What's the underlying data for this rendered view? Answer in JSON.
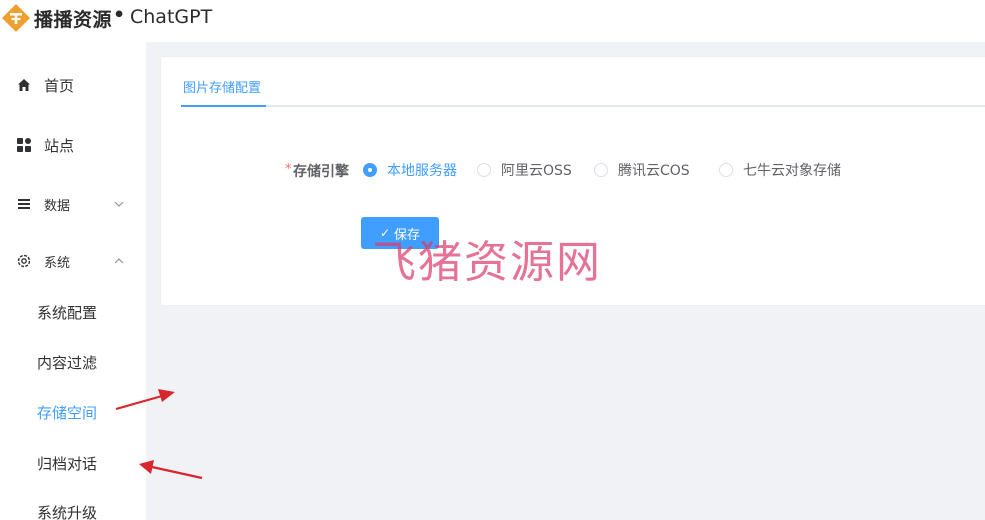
{
  "header": {
    "brand": "播播资源",
    "dot": "•",
    "app_name": "ChatGPT"
  },
  "sidebar": {
    "items": [
      {
        "label": "首页",
        "icon": "home-icon"
      },
      {
        "label": "站点",
        "icon": "grid-icon"
      },
      {
        "label": "数据",
        "icon": "list-icon",
        "chevron": "down"
      },
      {
        "label": "系统",
        "icon": "gear-icon",
        "chevron": "up"
      }
    ],
    "sub_items": [
      {
        "label": "系统配置",
        "active": false
      },
      {
        "label": "内容过滤",
        "active": false
      },
      {
        "label": "存储空间",
        "active": true
      },
      {
        "label": "归档对话",
        "active": false
      },
      {
        "label": "系统升级",
        "active": false
      }
    ]
  },
  "main": {
    "tab_label": "图片存储配置",
    "form": {
      "required_mark": "*",
      "label": "存储引擎",
      "options": [
        {
          "label": "本地服务器",
          "checked": true
        },
        {
          "label": "阿里云OSS",
          "checked": false
        },
        {
          "label": "腾讯云COS",
          "checked": false
        },
        {
          "label": "七牛云对象存储",
          "checked": false
        }
      ]
    },
    "save_label": "保存",
    "save_icon": "✓"
  },
  "watermark": "飞猪资源网",
  "colors": {
    "accent": "#409eff",
    "background": "#f0f2f5",
    "required": "#f56c6c",
    "arrow": "#d9262c",
    "logo": "#f0a030"
  }
}
